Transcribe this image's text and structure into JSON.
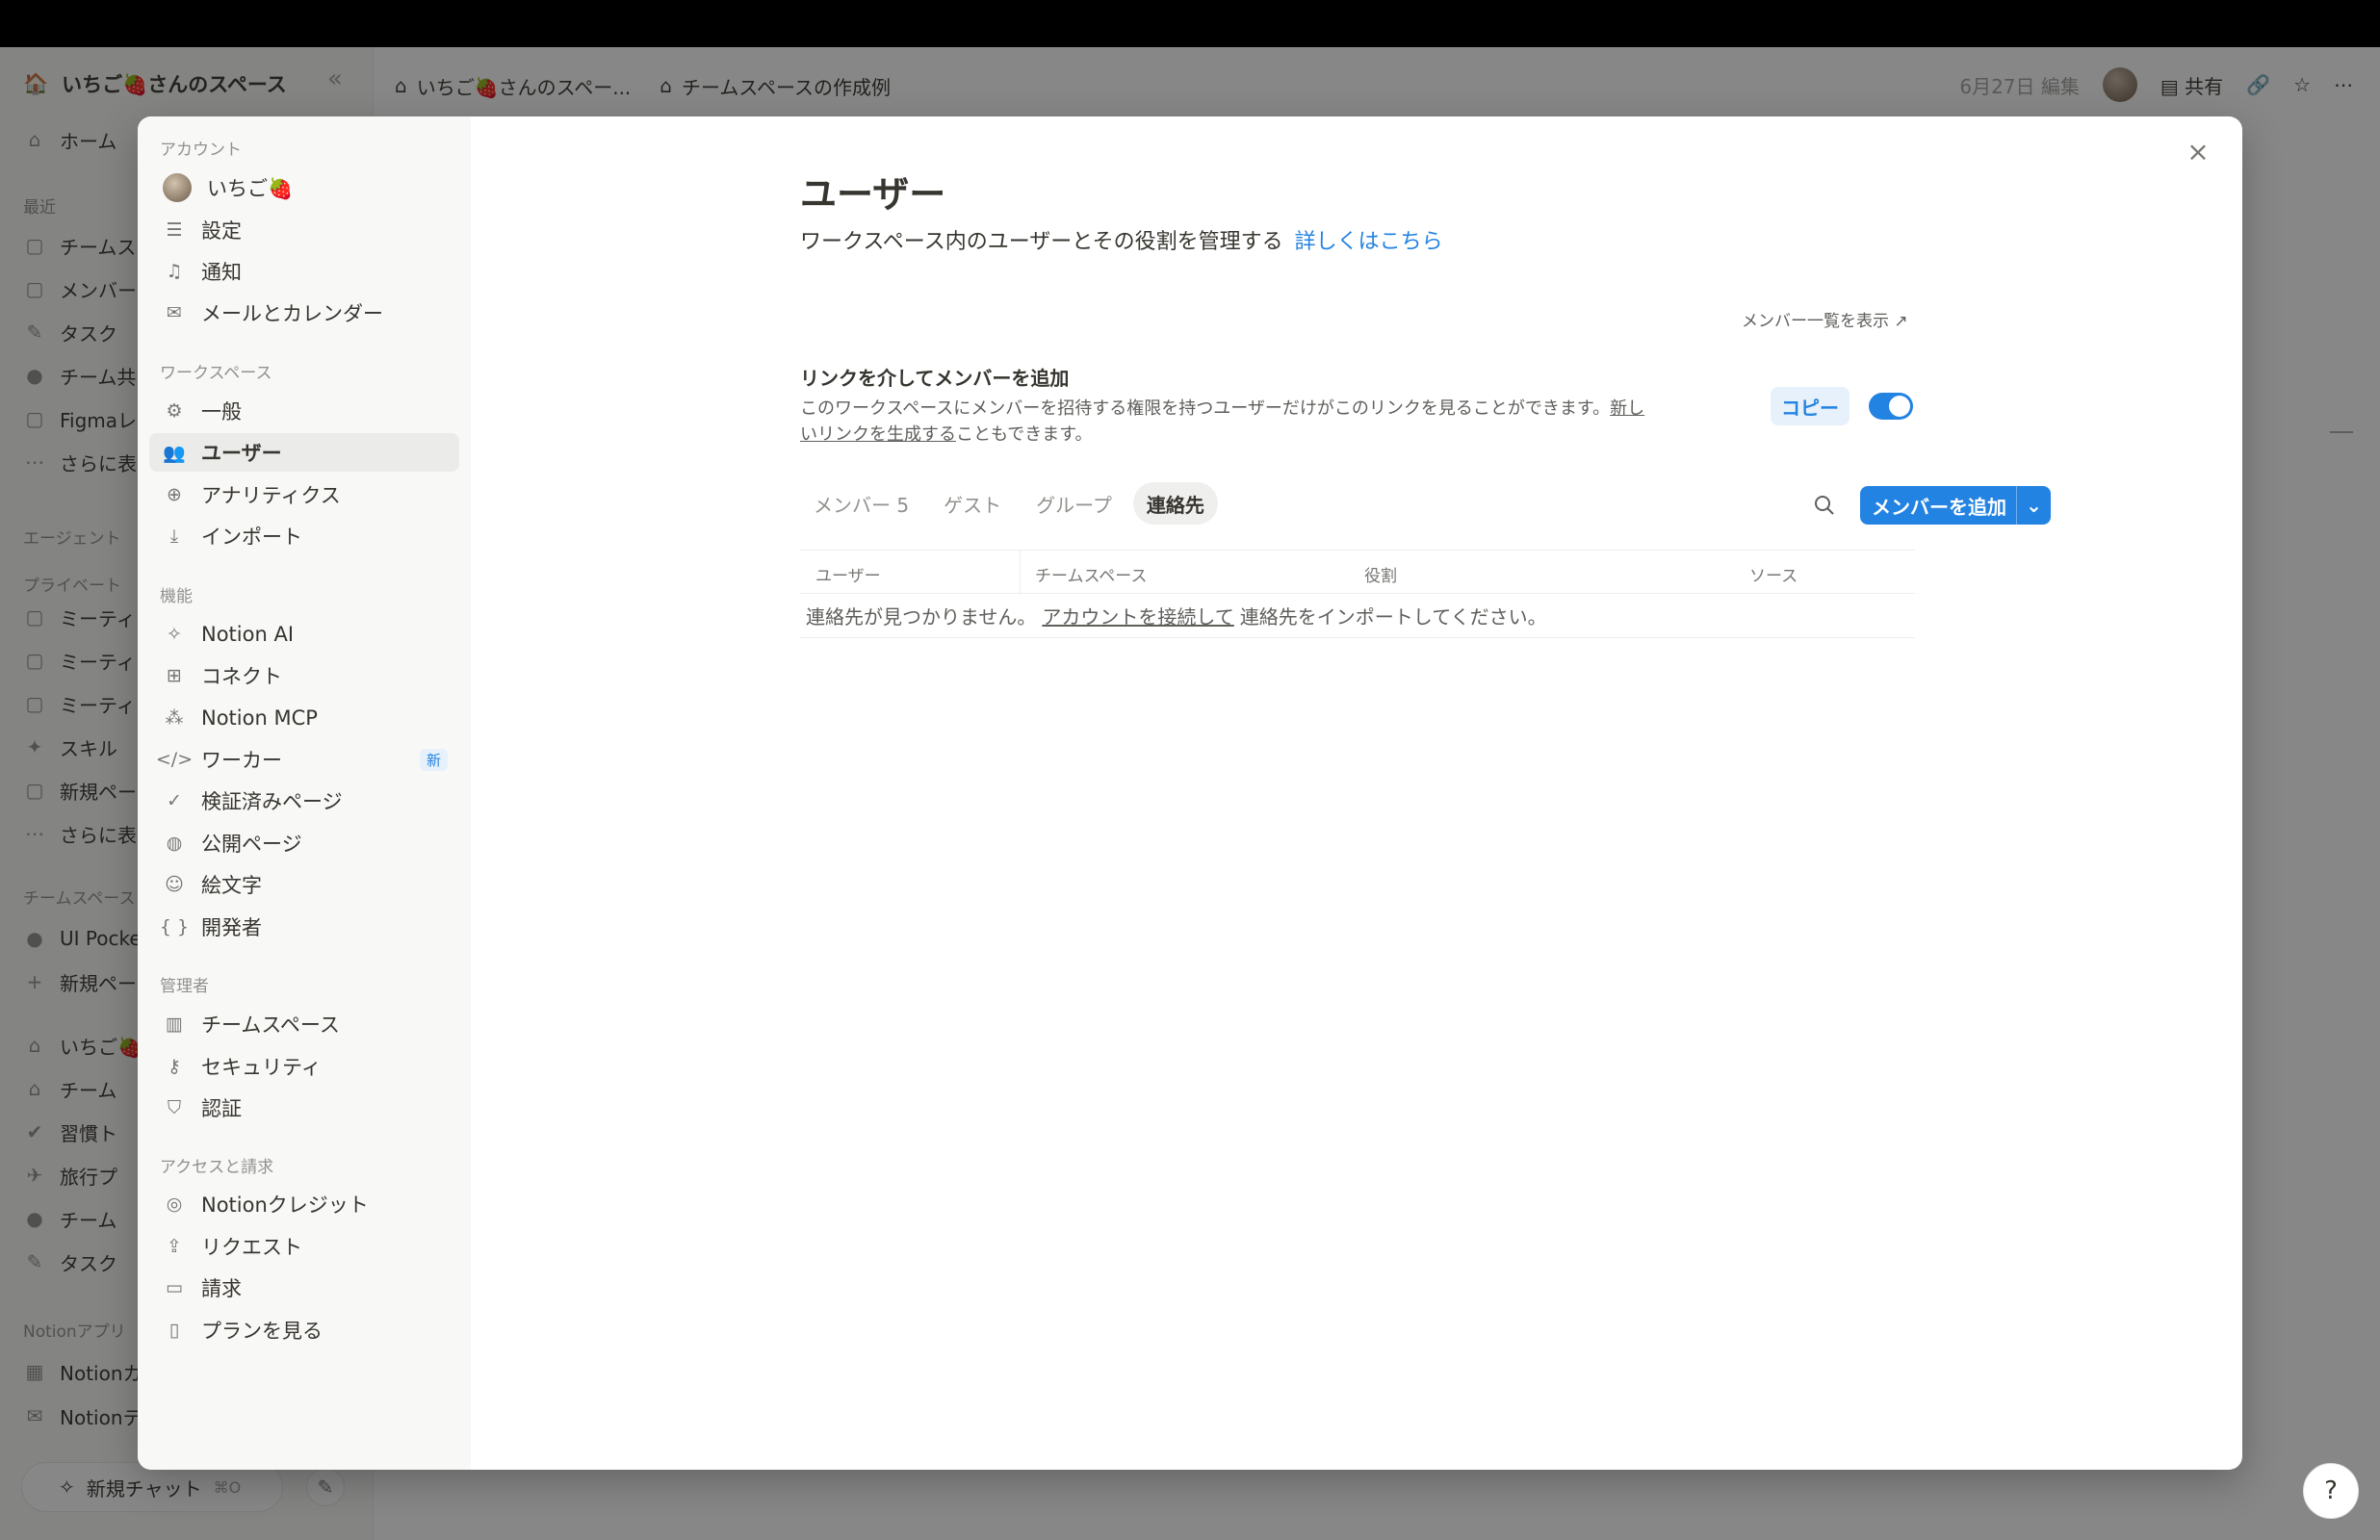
{
  "workspace": {
    "name": "いちご🍓さんのスペース"
  },
  "app_sidebar": {
    "home": "ホーム",
    "recent_label": "最近",
    "recent": [
      "チームス",
      "メンバー",
      "タスク",
      "チーム共",
      "Figmaレ",
      "さらに表"
    ],
    "agent_label": "エージェント",
    "private_label": "プライベート",
    "private": [
      "ミーティ",
      "ミーティ",
      "ミーティ",
      "スキル",
      "新規ペー",
      "さらに表"
    ],
    "teamspace_label": "チームスペース",
    "teamspaces": [
      "UI Pocke",
      "新規ペー"
    ],
    "ws_group": "いちご🍓",
    "ws_items": [
      "チーム",
      "習慣ト",
      "旅行プ",
      "チーム",
      "タスク"
    ],
    "notion_apps_label": "Notionアプリ",
    "notion_apps": [
      "Notionカ",
      "Notionテ"
    ],
    "new_chat": "新規チャット",
    "new_chat_kbd": "⌘O"
  },
  "breadcrumbs": [
    "いちご🍓さんのスペー...",
    "チームスペースの作成例"
  ],
  "topbar": {
    "edited": "6月27日 編集",
    "share": "共有"
  },
  "settings_sidebar": {
    "account_label": "アカウント",
    "account": [
      "いちご🍓",
      "設定",
      "通知",
      "メールとカレンダー"
    ],
    "workspace_label": "ワークスペース",
    "workspace": [
      "一般",
      "ユーザー",
      "アナリティクス",
      "インポート"
    ],
    "features_label": "機能",
    "features": [
      "Notion AI",
      "コネクト",
      "Notion MCP",
      "ワーカー",
      "検証済みページ",
      "公開ページ",
      "絵文字",
      "開発者"
    ],
    "new_badge": "新",
    "admin_label": "管理者",
    "admin": [
      "チームスペース",
      "セキュリティ",
      "認証"
    ],
    "billing_label": "アクセスと請求",
    "billing": [
      "Notionクレジット",
      "リクエスト",
      "請求",
      "プランを見る"
    ]
  },
  "main": {
    "title": "ユーザー",
    "subtitle": "ワークスペース内のユーザーとその役割を管理する",
    "learn_more": "詳しくはこちら",
    "show_members": "メンバー一覧を表示 ↗",
    "invite_title": "リンクを介してメンバーを追加",
    "invite_desc_1": "このワークスペースにメンバーを招待する権限を持つユーザーだけがこのリンクを見ることができます。",
    "invite_desc_link": "新しいリンクを生成する",
    "invite_desc_2": "こともできます。",
    "copy": "コピー",
    "link_enabled": true,
    "tabs": [
      "メンバー 5",
      "ゲスト",
      "グループ",
      "連絡先"
    ],
    "active_tab": "連絡先",
    "add_member": "メンバーを追加",
    "columns": [
      "ユーザー",
      "チームスペース",
      "役割",
      "ソース"
    ],
    "empty_1": "連絡先が見つかりません。",
    "empty_link": "アカウントを接続して",
    "empty_2": "連絡先をインポートしてください。"
  },
  "colors": {
    "accent": "#2383e2",
    "overlay": "rgba(15,15,15,0.5)"
  }
}
